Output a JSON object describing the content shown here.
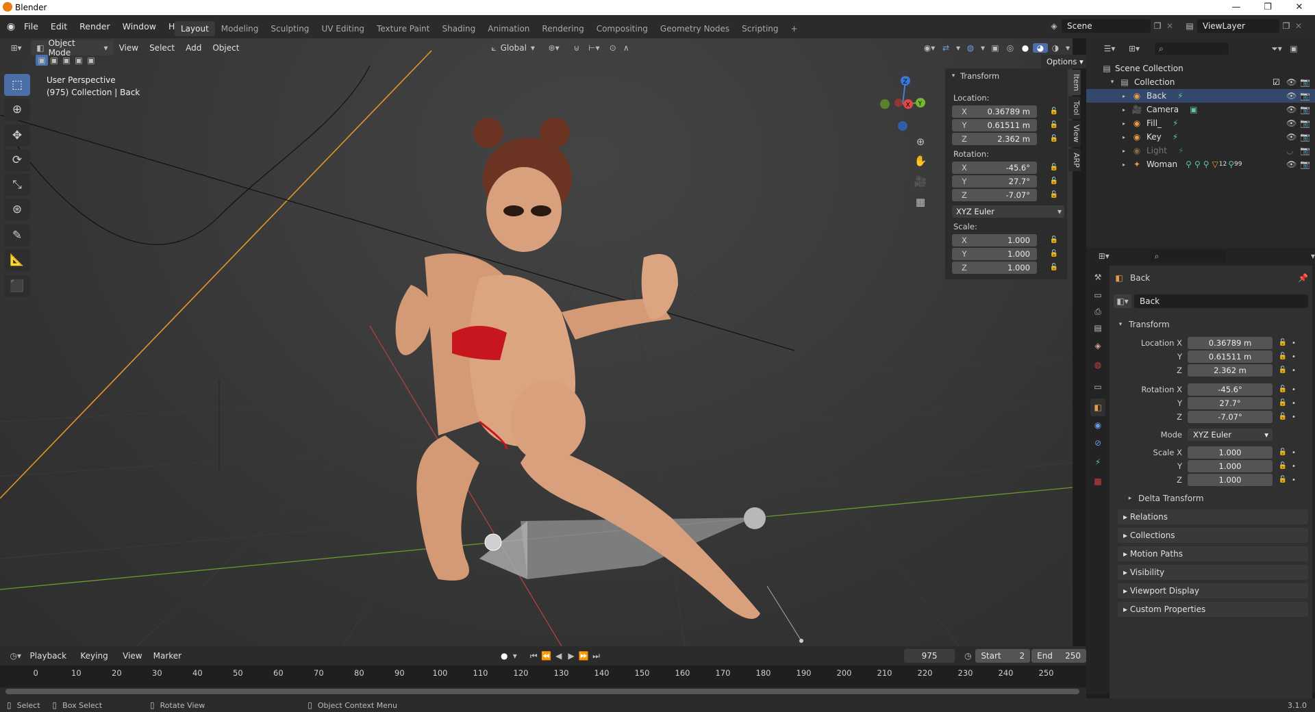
{
  "app": {
    "title": "Blender"
  },
  "window_controls": {
    "minimize": "—",
    "restore": "❐",
    "close": "✕"
  },
  "menubar": [
    "File",
    "Edit",
    "Render",
    "Window",
    "Help"
  ],
  "workspaces": [
    "Layout",
    "Modeling",
    "Sculpting",
    "UV Editing",
    "Texture Paint",
    "Shading",
    "Animation",
    "Rendering",
    "Compositing",
    "Geometry Nodes",
    "Scripting"
  ],
  "workspace_add": "+",
  "scene": {
    "name": "Scene",
    "view_layer": "ViewLayer"
  },
  "viewport": {
    "mode": "Object Mode",
    "menus": [
      "View",
      "Select",
      "Add",
      "Object"
    ],
    "transform_orientation": "Global",
    "options_label": "Options",
    "info_line1": "User Perspective",
    "info_line2": "(975) Collection | Back",
    "gizmo": {
      "z": "Z",
      "y": "Y",
      "x": "X"
    }
  },
  "npanel": {
    "title": "Transform",
    "location_label": "Location:",
    "location": [
      {
        "axis": "X",
        "value": "0.36789 m"
      },
      {
        "axis": "Y",
        "value": "0.61511 m"
      },
      {
        "axis": "Z",
        "value": "2.362 m"
      }
    ],
    "rotation_label": "Rotation:",
    "rotation": [
      {
        "axis": "X",
        "value": "-45.6°"
      },
      {
        "axis": "Y",
        "value": "27.7°"
      },
      {
        "axis": "Z",
        "value": "-7.07°"
      }
    ],
    "rotation_mode": "XYZ Euler",
    "scale_label": "Scale:",
    "scale": [
      {
        "axis": "X",
        "value": "1.000"
      },
      {
        "axis": "Y",
        "value": "1.000"
      },
      {
        "axis": "Z",
        "value": "1.000"
      }
    ],
    "tabs": [
      "Item",
      "Tool",
      "View",
      "ARP"
    ]
  },
  "outliner": {
    "root": "Scene Collection",
    "collection": "Collection",
    "items": [
      {
        "name": "Back",
        "selected": true
      },
      {
        "name": "Camera",
        "selected": false
      },
      {
        "name": "Fill_",
        "selected": false
      },
      {
        "name": "Key",
        "selected": false
      },
      {
        "name": "Light",
        "selected": false
      },
      {
        "name": "Woman",
        "selected": false
      }
    ],
    "woman_count_a": "12",
    "woman_count_b": "99"
  },
  "properties": {
    "object_name": "Back",
    "datablock_name": "Back",
    "transform_title": "Transform",
    "location_x_label": "Location X",
    "location": [
      "0.36789 m",
      "0.61511 m",
      "2.362 m"
    ],
    "rotation_x_label": "Rotation X",
    "rotation": [
      "-45.6°",
      "27.7°",
      "-7.07°"
    ],
    "mode_label": "Mode",
    "mode_value": "XYZ Euler",
    "scale_x_label": "Scale X",
    "scale": [
      "1.000",
      "1.000",
      "1.000"
    ],
    "y_label": "Y",
    "z_label": "Z",
    "sections": [
      "Delta Transform",
      "Relations",
      "Collections",
      "Motion Paths",
      "Visibility",
      "Viewport Display",
      "Custom Properties"
    ]
  },
  "timeline": {
    "menus": [
      "Playback",
      "Keying",
      "View",
      "Marker"
    ],
    "current_frame": "975",
    "start_label": "Start",
    "start": "2",
    "end_label": "End",
    "end": "250",
    "ticks": [
      "0",
      "10",
      "20",
      "30",
      "40",
      "50",
      "60",
      "70",
      "80",
      "90",
      "100",
      "110",
      "120",
      "130",
      "140",
      "150",
      "160",
      "170",
      "180",
      "190",
      "200",
      "210",
      "220",
      "230",
      "240",
      "250"
    ]
  },
  "statusbar": {
    "select": "Select",
    "box_select": "Box Select",
    "rotate_view": "Rotate View",
    "context_menu": "Object Context Menu",
    "version": "3.1.0"
  }
}
